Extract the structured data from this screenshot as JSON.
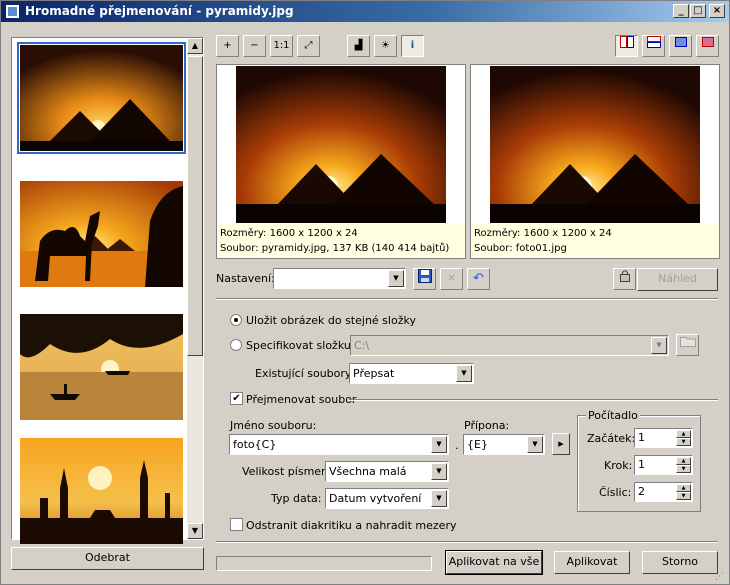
{
  "window": {
    "title": "Hromadné přejmenování - pyramidy.jpg",
    "minimize": "_",
    "maximize": "□",
    "close": "×"
  },
  "thumbnails": {
    "items": [
      {
        "name": "pyramids-sunset",
        "selected": true
      },
      {
        "name": "camel-pyramids"
      },
      {
        "name": "palm-boat-sunset"
      },
      {
        "name": "mosque-sunset"
      }
    ],
    "remove_label": "Odebrat"
  },
  "toolbar": {
    "zoom_in": "+",
    "zoom_out": "−",
    "actual_size": "1:1",
    "fit": "⤢",
    "histogram": "▟",
    "adjust": "☀",
    "info": "i"
  },
  "preview": {
    "left": {
      "dimensions": "Rozměry: 1600 x 1200 x 24",
      "file": "Soubor: pyramidy.jpg, 137 KB (140 414 bajtů)"
    },
    "right": {
      "dimensions": "Rozměry: 1600 x 1200 x 24",
      "file": "Soubor: foto01.jpg"
    }
  },
  "settings": {
    "label": "Nastavení:",
    "value": "",
    "preview_button": "Náhled"
  },
  "save": {
    "same_folder_label": "Uložit obrázek do stejné složky",
    "specify_folder_label": "Specifikovat složku:",
    "folder_value": "C:\\",
    "existing_label": "Existující soubory:",
    "existing_value": "Přepsat"
  },
  "rename": {
    "checkbox_label": "Přejmenovat soubor",
    "filename_label": "Jméno souboru:",
    "filename_value": "foto{C}",
    "dot": ".",
    "extension_label": "Přípona:",
    "extension_value": "{E}",
    "case_label": "Velikost písmen:",
    "case_value": "Všechna malá",
    "date_label": "Typ data:",
    "date_value": "Datum vytvoření",
    "more_arrow": "▸"
  },
  "counter": {
    "title": "Počítadlo",
    "start_label": "Začátek:",
    "start_value": "1",
    "step_label": "Krok:",
    "step_value": "1",
    "digits_label": "Číslic:",
    "digits_value": "2"
  },
  "remove_diacritics_label": "Odstranit diakritiku a nahradit mezery",
  "buttons": {
    "apply_all": "Aplikovat na vše",
    "apply": "Aplikovat",
    "cancel": "Storno"
  },
  "accent": "#0a246a"
}
